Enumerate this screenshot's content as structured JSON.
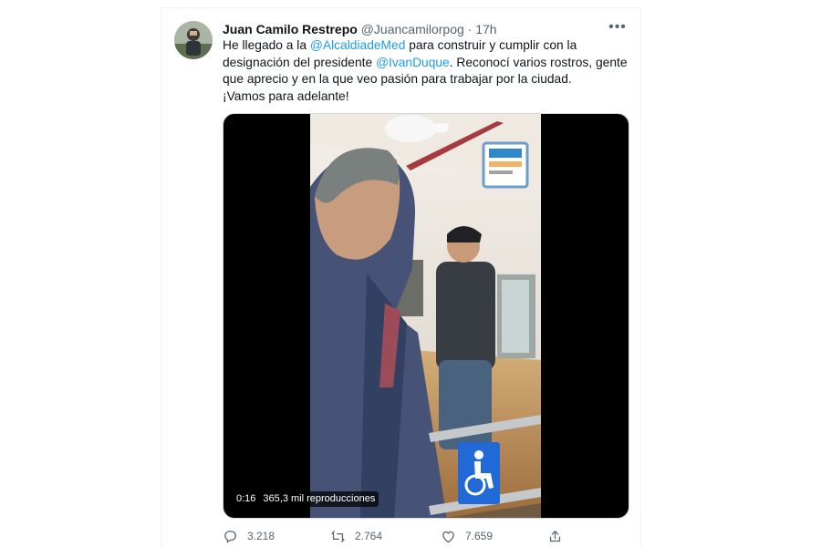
{
  "tweet": {
    "author": {
      "display_name": "Juan Camilo Restrepo",
      "handle": "@Juancamilorpog",
      "separator": "·",
      "timestamp": "17h"
    },
    "more_label": "•••",
    "text": {
      "line1_prefix": "He llegado a la ",
      "mention1": "@AlcaldiadeMed",
      "line1_suffix": " para construir y cumplir con la designación del presidente ",
      "mention2": "@IvanDuque",
      "line2_suffix": ". Reconocí varios rostros, gente que aprecio y en la que veo pasión para trabajar por la ciudad.",
      "line3": "¡Vamos para adelante!"
    },
    "video": {
      "duration": "0:16",
      "views": "365,3 mil reproducciones",
      "icons": [
        "wheelchair-sign-icon"
      ]
    },
    "actions": {
      "replies": "3.218",
      "retweets": "2.764",
      "likes": "7.659"
    },
    "colors": {
      "link": "#1d9bf0",
      "muted": "#536471",
      "text": "#0f1419"
    },
    "icons": [
      "reply-icon",
      "retweet-icon",
      "like-icon",
      "share-icon",
      "more-icon"
    ]
  }
}
